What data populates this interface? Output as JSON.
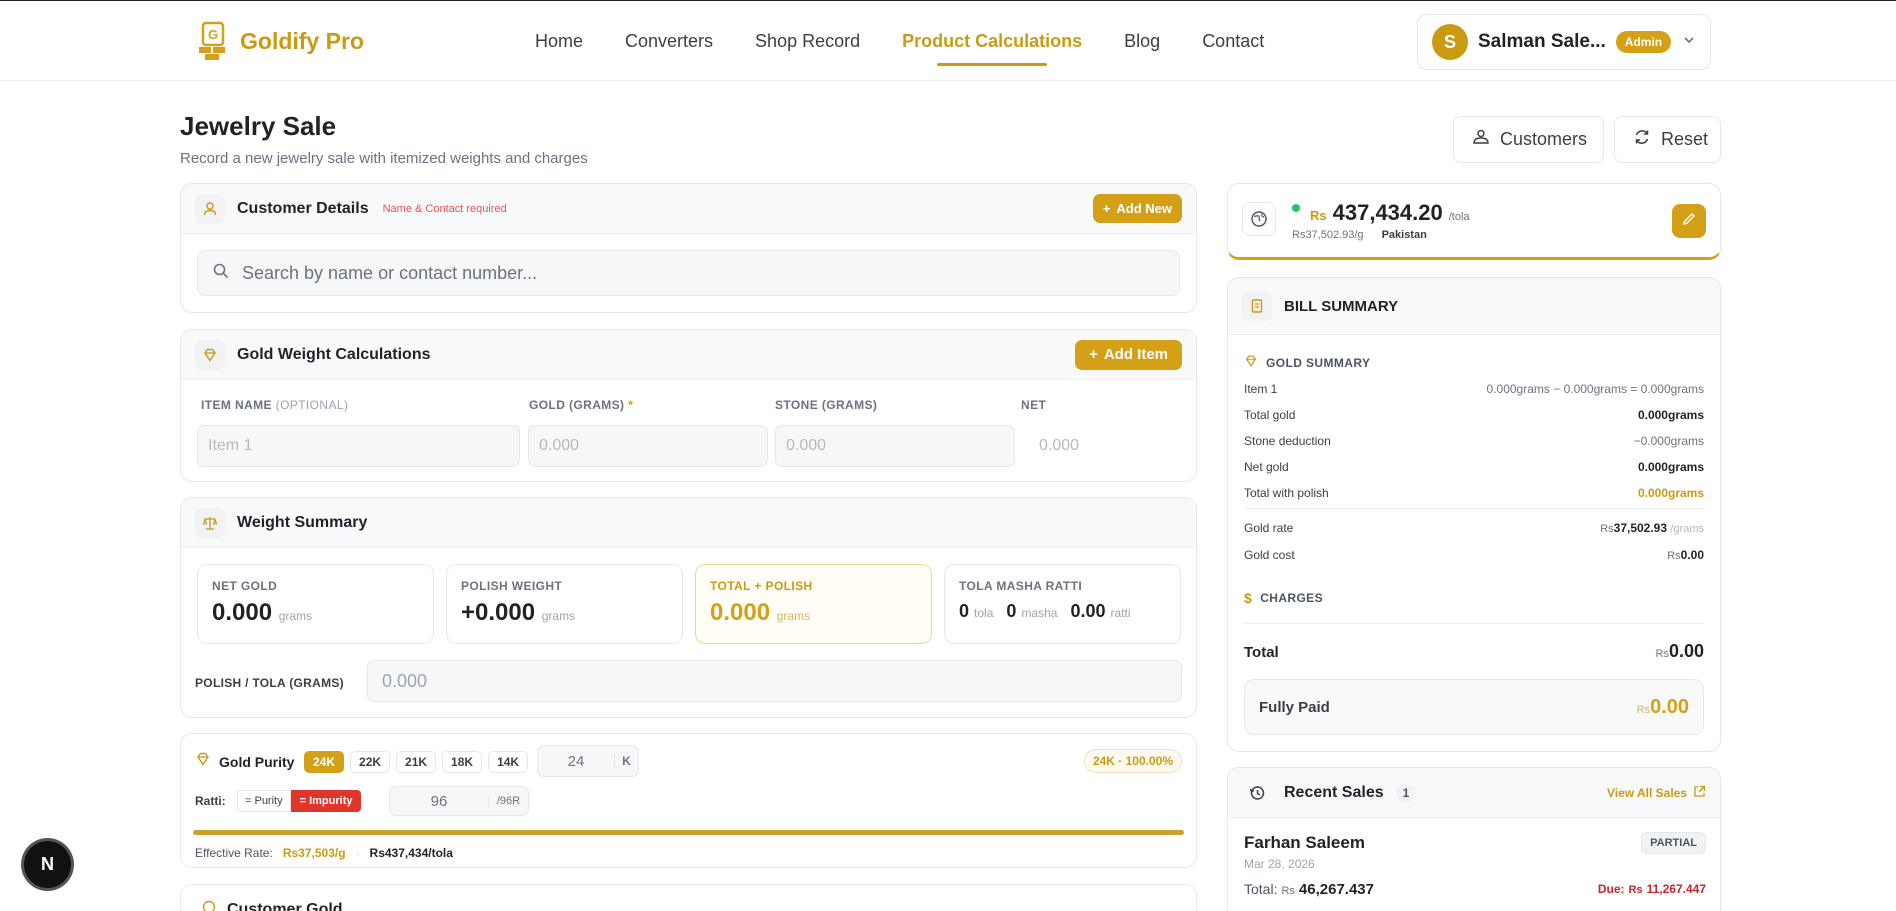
{
  "header": {
    "brand": "Goldify Pro",
    "nav": [
      "Home",
      "Converters",
      "Shop Record",
      "Product Calculations",
      "Blog",
      "Contact"
    ],
    "active_nav": "Product Calculations",
    "user": {
      "initial": "S",
      "name": "Salman Sale...",
      "role": "Admin"
    }
  },
  "page": {
    "title": "Jewelry Sale",
    "subtitle": "Record a new jewelry sale with itemized weights and charges",
    "customers_btn": "Customers",
    "reset_btn": "Reset"
  },
  "customer": {
    "title": "Customer Details",
    "required_note": "Name & Contact required",
    "add_new": "Add New",
    "search_placeholder": "Search by name or contact number..."
  },
  "gold_calc": {
    "title": "Gold Weight Calculations",
    "add_item": "Add Item",
    "col_item": "ITEM NAME",
    "col_item_opt": "(OPTIONAL)",
    "col_gold": "GOLD (GRAMS)",
    "col_gold_star": "*",
    "col_stone": "STONE (GRAMS)",
    "col_net": "NET",
    "item_placeholder": "Item 1",
    "gold_placeholder": "0.000",
    "stone_placeholder": "0.000",
    "net_value": "0.000"
  },
  "weight_summary": {
    "title": "Weight Summary",
    "stats": [
      {
        "label": "NET GOLD",
        "value": "0.000",
        "unit": "grams"
      },
      {
        "label": "POLISH WEIGHT",
        "value": "+0.000",
        "unit": "grams"
      },
      {
        "label": "TOTAL + POLISH",
        "value": "0.000",
        "unit": "grams"
      }
    ],
    "tmr_label": "TOLA MASHA RATTI",
    "tola": "0",
    "tola_u": "tola",
    "masha": "0",
    "masha_u": "masha",
    "ratti": "0.00",
    "ratti_u": "ratti",
    "polish_label": "POLISH / TOLA (GRAMS)",
    "polish_placeholder": "0.000"
  },
  "purity": {
    "title": "Gold Purity",
    "karats": [
      "24K",
      "22K",
      "21K",
      "18K",
      "14K"
    ],
    "selected": "24K",
    "custom_value": "24",
    "custom_unit": "K",
    "result_badge": "24K · 100.00%",
    "ratti_label": "Ratti:",
    "eq_purity": "= Purity",
    "eq_impurity": "= Impurity",
    "ratti_value": "96",
    "ratti_unit": "/96R",
    "purity_fill": 1.0,
    "effective_label": "Effective Rate:",
    "effective_g": "Rs37,503/g",
    "effective_tola": "Rs437,434/tola"
  },
  "customer_gold": {
    "title": "Customer Gold"
  },
  "rate": {
    "currency": "Rs",
    "value": "437,434.20",
    "per": "/tola",
    "per_gram": "Rs37,502.93/g",
    "country": "Pakistan"
  },
  "bill": {
    "title": "BILL SUMMARY",
    "gold_summary": "GOLD SUMMARY",
    "rows": [
      {
        "label": "Item 1",
        "value": "0.000grams − 0.000grams = 0.000grams"
      },
      {
        "label": "Total gold",
        "value": "0.000grams"
      },
      {
        "label": "Stone deduction",
        "value": "−0.000grams"
      },
      {
        "label": "Net gold",
        "value": "0.000grams"
      },
      {
        "label": "Total with polish",
        "value": "0.000grams"
      }
    ],
    "gold_rate_label": "Gold rate",
    "gold_rate_cur": "Rs",
    "gold_rate_value": "37,502.93",
    "gold_rate_unit": "/grams",
    "gold_cost_label": "Gold cost",
    "gold_cost_cur": "Rs",
    "gold_cost_value": "0.00",
    "charges": "CHARGES",
    "total_label": "Total",
    "total_cur": "Rs",
    "total_value": "0.00",
    "paid_label": "Fully Paid",
    "paid_cur": "Rs",
    "paid_value": "0.00"
  },
  "recent": {
    "title": "Recent Sales",
    "count": "1",
    "view_all": "View All Sales",
    "sale": {
      "name": "Farhan Saleem",
      "date": "Mar 28, 2026",
      "status": "PARTIAL",
      "total_label": "Total:",
      "total_cur": "Rs",
      "total_value": "46,267.437",
      "due_label": "Due:",
      "due_cur": "Rs",
      "due_value": "11,267.447"
    }
  },
  "fab_letter": "N",
  "colors": {
    "gold": "#d4a017",
    "danger": "#e0352b",
    "success": "#22c55e"
  }
}
